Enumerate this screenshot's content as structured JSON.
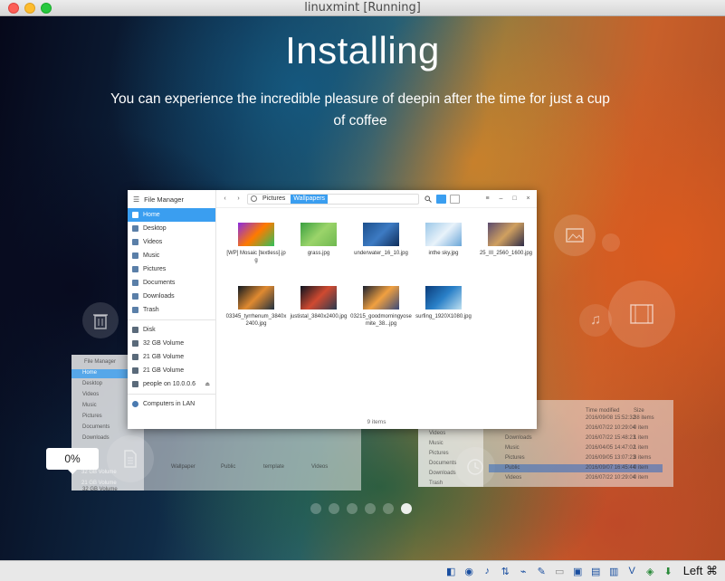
{
  "window": {
    "title": "linuxmint [Running]"
  },
  "installer": {
    "heading": "Installing",
    "subtitle": "You can experience the incredible pleasure of deepin after the time for just a cup of coffee",
    "progress_label": "0%",
    "progress_value": 0,
    "slide_count": 6,
    "active_slide": 6
  },
  "file_manager": {
    "title": "File Manager",
    "sidebar": [
      {
        "label": "Home",
        "active": true,
        "icon": "home-icon"
      },
      {
        "label": "Desktop",
        "icon": "desktop-icon"
      },
      {
        "label": "Videos",
        "icon": "video-icon"
      },
      {
        "label": "Music",
        "icon": "music-icon"
      },
      {
        "label": "Pictures",
        "icon": "picture-icon"
      },
      {
        "label": "Documents",
        "icon": "document-icon"
      },
      {
        "label": "Downloads",
        "icon": "download-icon"
      },
      {
        "label": "Trash",
        "icon": "trash-icon"
      }
    ],
    "devices": [
      {
        "label": "Disk"
      },
      {
        "label": "32 GB Volume"
      },
      {
        "label": "21 GB Volume"
      },
      {
        "label": "21 GB Volume"
      },
      {
        "label": "people on 10.0.0.6"
      }
    ],
    "network": [
      {
        "label": "Computers in LAN"
      }
    ],
    "breadcrumb": [
      "Pictures",
      "Wallpapers"
    ],
    "files": [
      {
        "name": "[WP] Mosaic [textless].jpg",
        "colors": [
          "#8a2be2",
          "#ff7a00",
          "#2fc05a"
        ]
      },
      {
        "name": "grass.jpg",
        "colors": [
          "#3aa040",
          "#9bd46a",
          "#6fb850"
        ]
      },
      {
        "name": "underwater_16_10.jpg",
        "colors": [
          "#1c4f8c",
          "#3d7bc3",
          "#0f2d5a"
        ]
      },
      {
        "name": "inthe sky.jpg",
        "colors": [
          "#9cc8e8",
          "#e8f2fa",
          "#6aa6d8"
        ]
      },
      {
        "name": "25_III_2560_1600.jpg",
        "colors": [
          "#5a4a6e",
          "#d0a060",
          "#2e2c48"
        ]
      },
      {
        "name": "03345_tyrrhenum_3840x2400.jpg",
        "colors": [
          "#101820",
          "#e08a30",
          "#203040"
        ]
      },
      {
        "name": "justistal_3840x2400.jpg",
        "colors": [
          "#0b1420",
          "#d04a30",
          "#2a3a50"
        ]
      },
      {
        "name": "03215_goodmorningyosemite_38...jpg",
        "colors": [
          "#1a2030",
          "#f0a040",
          "#3a4a7a"
        ]
      },
      {
        "name": "surfing_1920X1080.jpg",
        "colors": [
          "#0a3c7a",
          "#2a80c8",
          "#bfe0f0"
        ]
      }
    ],
    "status": "9 items"
  },
  "background_windows": {
    "left": {
      "title": "File Manager",
      "sidebar": [
        "Home",
        "Desktop",
        "Videos",
        "Music",
        "Pictures",
        "Documents",
        "Downloads"
      ],
      "volumes": [
        "32 GB Volume",
        "21 GB Volume"
      ],
      "folders": [
        "Wallpaper",
        "Public",
        "template",
        "Videos"
      ]
    },
    "right": {
      "sidebar": [
        "Videos",
        "Music",
        "Pictures",
        "Documents",
        "Downloads",
        "Trash"
      ],
      "headers": [
        "Time modified",
        "Size"
      ],
      "rows": [
        {
          "name": "",
          "date": "2016/09/08 15:52:32",
          "size": "38 items"
        },
        {
          "name": "Documents",
          "date": "2016/07/22 10:29:04",
          "size": "0 item"
        },
        {
          "name": "Downloads",
          "date": "2016/07/22 15:48:23",
          "size": "1 item"
        },
        {
          "name": "Music",
          "date": "2016/04/05 14:47:02",
          "size": "1 item"
        },
        {
          "name": "Pictures",
          "date": "2016/09/05 13:07:23",
          "size": "3 items"
        },
        {
          "name": "Public",
          "date": "2016/09/07 16:45:44",
          "size": "0 item"
        },
        {
          "name": "Videos",
          "date": "2016/07/22 10:29:04",
          "size": "0 item"
        }
      ]
    }
  },
  "statusbar": {
    "host_key": "Left ⌘"
  }
}
